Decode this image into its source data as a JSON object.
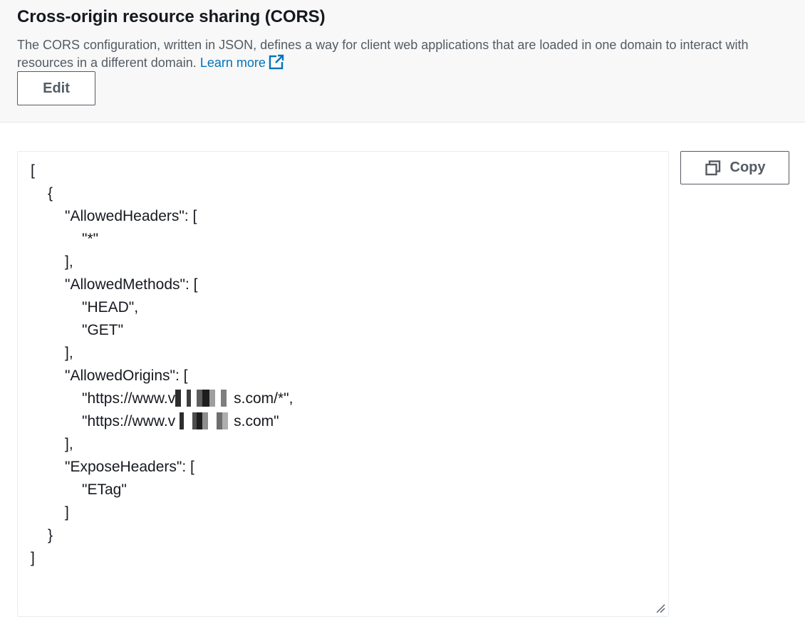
{
  "header": {
    "title": "Cross-origin resource sharing (CORS)",
    "description": "The CORS configuration, written in JSON, defines a way for client web applications that are loaded in one domain to interact with resources in a different domain.",
    "learn_more_label": "Learn more",
    "edit_label": "Edit"
  },
  "toolbar": {
    "copy_label": "Copy"
  },
  "icons": {
    "external_link": "external-link-icon",
    "copy": "copy-icon",
    "resize": "resize-handle-icon"
  },
  "colors": {
    "link": "#0073bb",
    "button_border": "#545b64",
    "header_bg": "#f8f8f8"
  },
  "code": {
    "lines": [
      {
        "indent": 0,
        "text": "["
      },
      {
        "indent": 1,
        "text": "{"
      },
      {
        "indent": 2,
        "text": "\"AllowedHeaders\": ["
      },
      {
        "indent": 3,
        "text": "\"*\""
      },
      {
        "indent": 2,
        "text": "],"
      },
      {
        "indent": 2,
        "text": "\"AllowedMethods\": ["
      },
      {
        "indent": 3,
        "text": "\"HEAD\","
      },
      {
        "indent": 3,
        "text": "\"GET\""
      },
      {
        "indent": 2,
        "text": "],"
      },
      {
        "indent": 2,
        "text": "\"AllowedOrigins\": ["
      },
      {
        "indent": 3,
        "text": "\"https://www.v",
        "redacted": true,
        "after": "s.com/*\","
      },
      {
        "indent": 3,
        "text": "\"https://www.v",
        "redacted": true,
        "after": "s.com\""
      },
      {
        "indent": 2,
        "text": "],"
      },
      {
        "indent": 2,
        "text": "\"ExposeHeaders\": ["
      },
      {
        "indent": 3,
        "text": "\"ETag\""
      },
      {
        "indent": 2,
        "text": "]"
      },
      {
        "indent": 1,
        "text": "}"
      },
      {
        "indent": 0,
        "text": "]"
      }
    ]
  }
}
